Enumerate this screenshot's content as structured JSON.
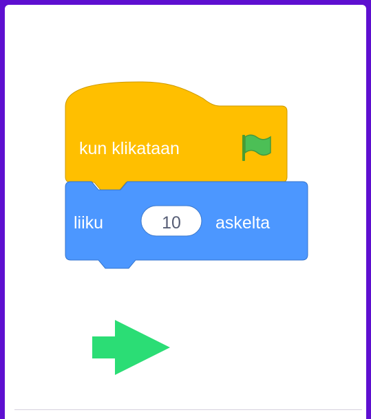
{
  "hat_block": {
    "label": "kun klikataan",
    "icon": "green-flag-icon",
    "color": "#ffbf00",
    "border_color": "#cc9900"
  },
  "motion_block": {
    "label_before": "liiku",
    "input_value": "10",
    "label_after": "askelta",
    "color": "#4c97ff",
    "border_color": "#3373cc"
  },
  "hint_arrow": {
    "icon": "right-arrow-icon",
    "color": "#2bdd75"
  },
  "frame": {
    "background": "#5e0fd0"
  }
}
